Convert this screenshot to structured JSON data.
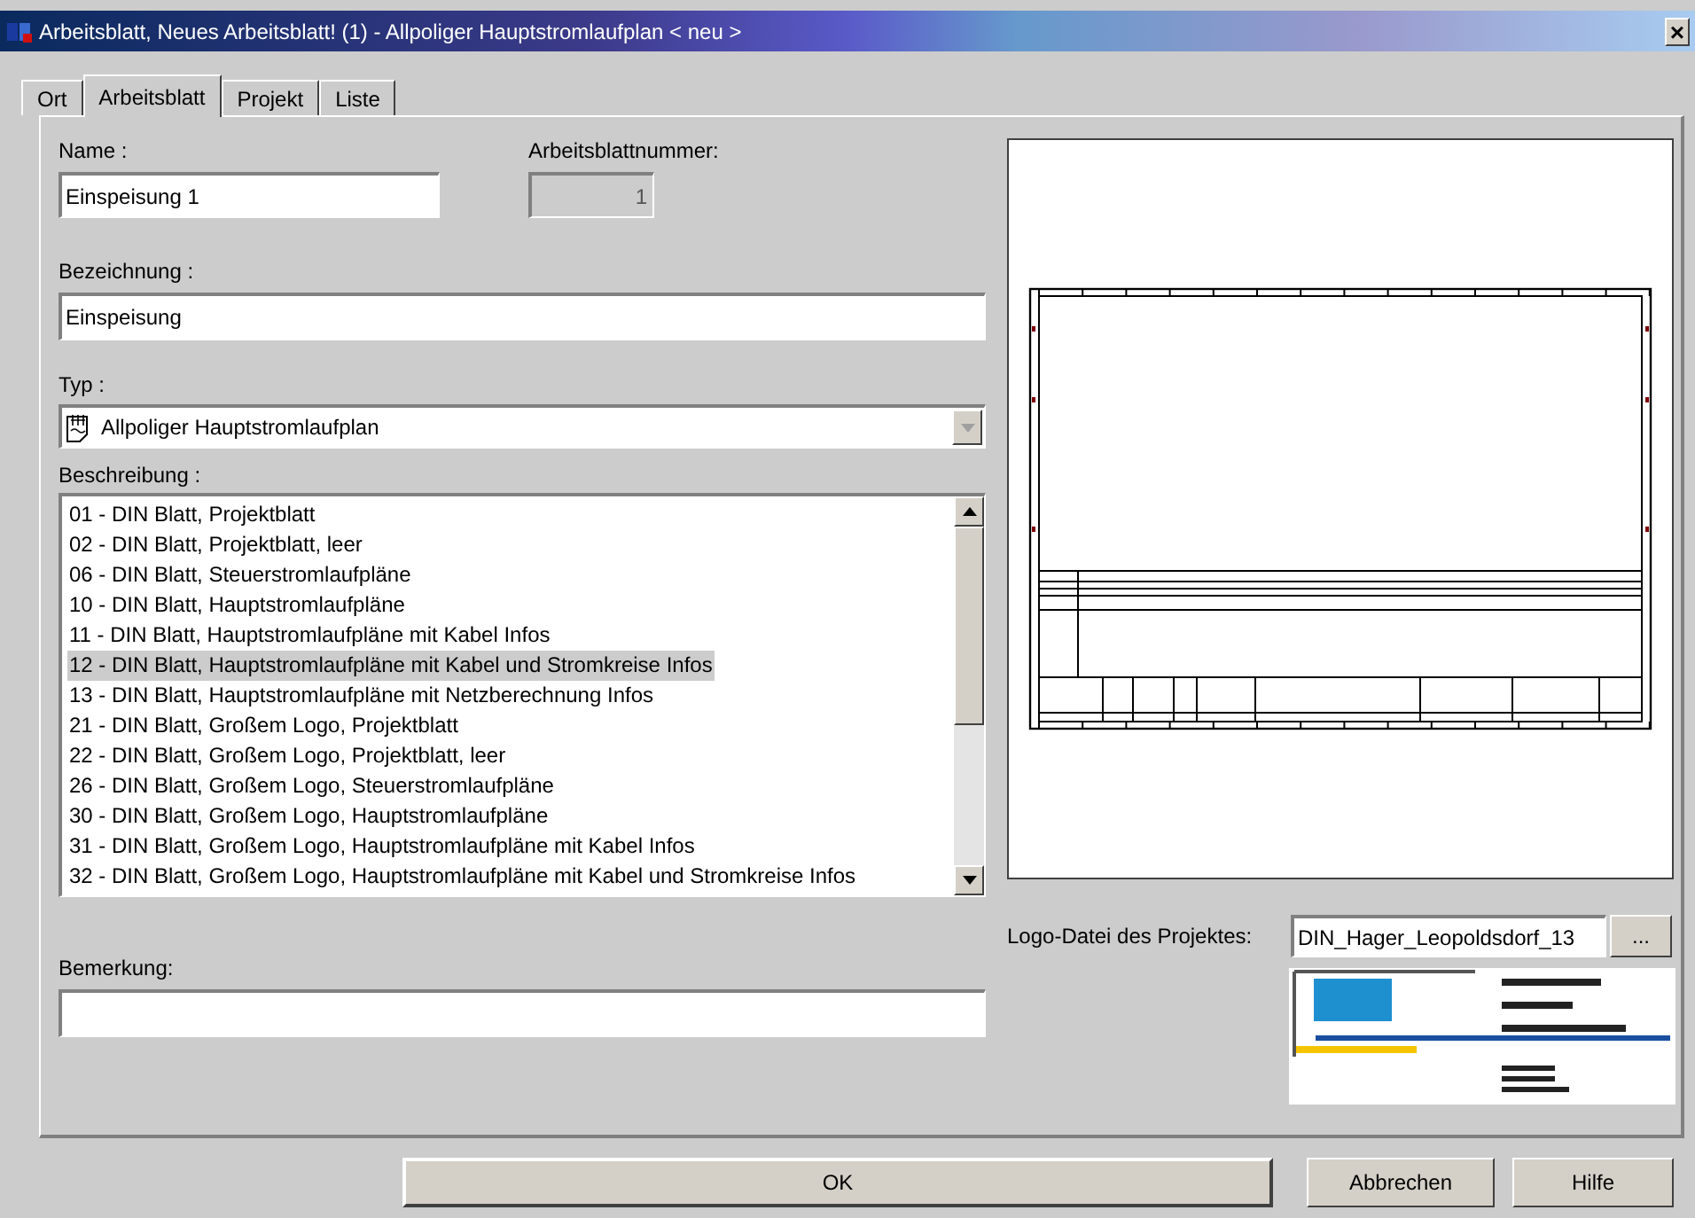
{
  "window": {
    "title": "Arbeitsblatt, Neues Arbeitsblatt! (1) - Allpoliger Hauptstromlaufplan < neu >",
    "close": "×"
  },
  "tabs": [
    {
      "label": "Ort",
      "selected": false
    },
    {
      "label": "Arbeitsblatt",
      "selected": true
    },
    {
      "label": "Projekt",
      "selected": false
    },
    {
      "label": "Liste",
      "selected": false
    }
  ],
  "name": {
    "label": "Name :",
    "value": "Einspeisung 1"
  },
  "sheet_number": {
    "label": "Arbeitsblattnummer:",
    "value": "1",
    "disabled": true
  },
  "designation": {
    "label": "Bezeichnung :",
    "value": "Einspeisung"
  },
  "type": {
    "label": "Typ :",
    "value": "Allpoliger Hauptstromlaufplan"
  },
  "description": {
    "label": "Beschreibung :",
    "items": [
      {
        "text": "01 - DIN Blatt, Projektblatt",
        "selected": false
      },
      {
        "text": "02 - DIN Blatt, Projektblatt, leer",
        "selected": false
      },
      {
        "text": "06 - DIN Blatt, Steuerstromlaufpläne",
        "selected": false
      },
      {
        "text": "10 - DIN Blatt, Hauptstromlaufpläne",
        "selected": false
      },
      {
        "text": "11 - DIN Blatt, Hauptstromlaufpläne mit Kabel Infos",
        "selected": false
      },
      {
        "text": "12 - DIN Blatt, Hauptstromlaufpläne mit Kabel und Stromkreise Infos",
        "selected": true
      },
      {
        "text": "13 - DIN Blatt, Hauptstromlaufpläne mit Netzberechnung Infos",
        "selected": false
      },
      {
        "text": "21 - DIN Blatt, Großem Logo, Projektblatt",
        "selected": false
      },
      {
        "text": "22 - DIN Blatt, Großem Logo, Projektblatt, leer",
        "selected": false
      },
      {
        "text": "26 - DIN Blatt, Großem Logo, Steuerstromlaufpläne",
        "selected": false
      },
      {
        "text": "30 - DIN Blatt, Großem Logo, Hauptstromlaufpläne",
        "selected": false
      },
      {
        "text": "31 - DIN Blatt, Großem Logo, Hauptstromlaufpläne mit Kabel Infos",
        "selected": false
      },
      {
        "text": "32 - DIN Blatt, Großem Logo, Hauptstromlaufpläne mit Kabel und Stromkreise Infos",
        "selected": false
      }
    ]
  },
  "remark": {
    "label": "Bemerkung:"
  },
  "logo_file": {
    "label": "Logo-Datei des Projektes:",
    "value": "DIN_Hager_Leopoldsdorf_13",
    "browse": "..."
  },
  "buttons": [
    "OK",
    "Abbrechen",
    "Hilfe"
  ]
}
